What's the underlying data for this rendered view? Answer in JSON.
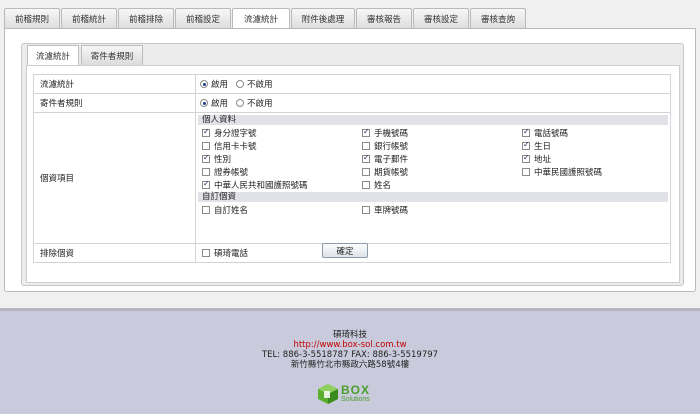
{
  "tabs": [
    "前稽規則",
    "前稽統計",
    "前稽排除",
    "前稽設定",
    "流濾統計",
    "附件後處理",
    "審核報告",
    "審核設定",
    "審核查詢"
  ],
  "active_tab": 4,
  "subtabs": [
    "流濾統計",
    "寄件者規則"
  ],
  "rows": {
    "stats": {
      "label": "流濾統計",
      "options": [
        {
          "label": "啟用",
          "checked": true
        },
        {
          "label": "不啟用",
          "checked": false
        }
      ]
    },
    "sender": {
      "label": "寄件者規則",
      "options": [
        {
          "label": "啟用",
          "checked": true
        },
        {
          "label": "不啟用",
          "checked": false
        }
      ]
    },
    "personal": {
      "label": "個資項目",
      "section1": "個人資料",
      "items": [
        {
          "label": "身分證字號",
          "checked": true
        },
        {
          "label": "手機號碼",
          "checked": true
        },
        {
          "label": "電話號碼",
          "checked": true
        },
        {
          "label": "信用卡卡號",
          "checked": false
        },
        {
          "label": "銀行帳號",
          "checked": false
        },
        {
          "label": "生日",
          "checked": true
        },
        {
          "label": "性別",
          "checked": true
        },
        {
          "label": "電子郵件",
          "checked": true
        },
        {
          "label": "地址",
          "checked": true
        },
        {
          "label": "證券帳號",
          "checked": false
        },
        {
          "label": "期貨帳號",
          "checked": false
        },
        {
          "label": "中華民國護照號碼",
          "checked": false
        },
        {
          "label": "中華人民共和國護照號碼",
          "checked": true
        },
        {
          "label": "姓名",
          "checked": false
        }
      ],
      "section2": "自訂個資",
      "custom_items": [
        {
          "label": "自訂姓名",
          "checked": false
        },
        {
          "label": "車牌號碼",
          "checked": false
        }
      ]
    },
    "exclude": {
      "label": "排除個資",
      "items": [
        {
          "label": "碩琦電話",
          "checked": false
        }
      ]
    }
  },
  "confirm_label": "確定",
  "footer": {
    "company": "碩琦科技",
    "url": "http://www.box-sol.com.tw",
    "tel": "TEL: 886-3-5518787  FAX: 886-3-5519797",
    "address": "新竹縣竹北市縣政六路58號4樓",
    "logo_word": "BOX",
    "logo_sub": "Solutions"
  }
}
